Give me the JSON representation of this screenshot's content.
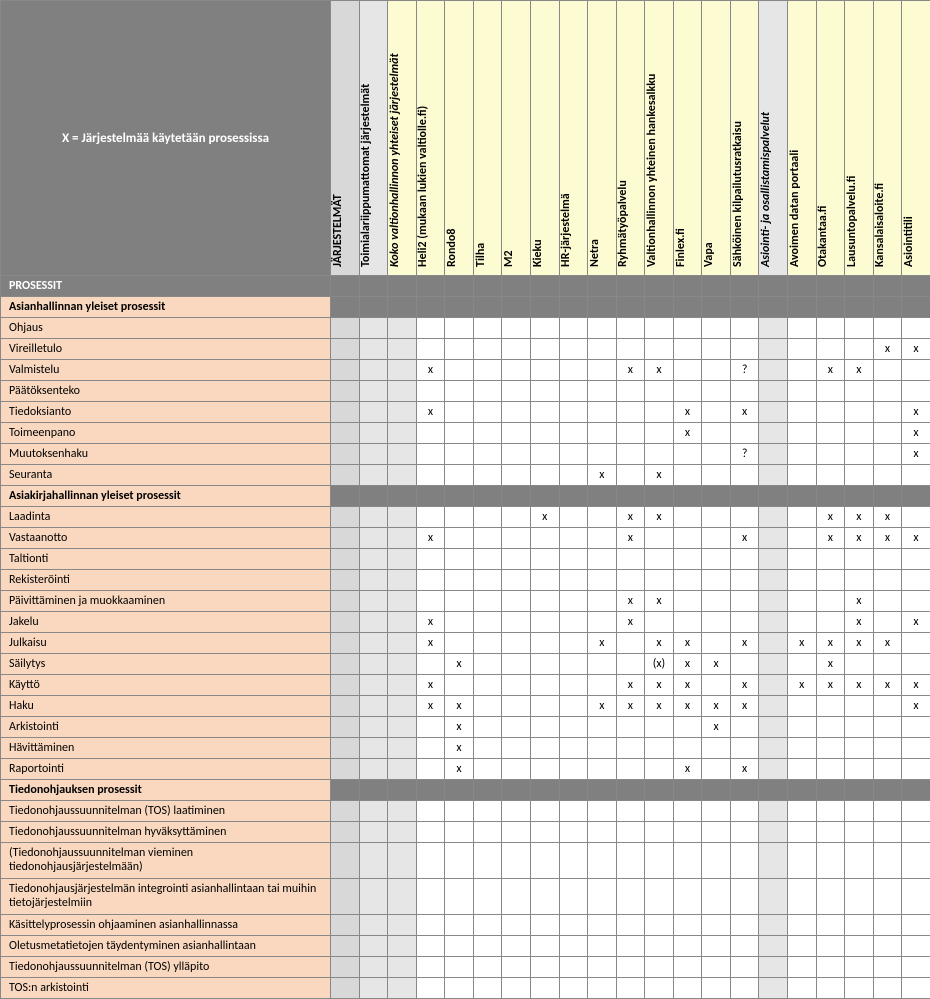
{
  "legend": "X = Järjestelmää käytetään prosessissa",
  "cols": [
    {
      "label": "JÄRJESTELMÄT",
      "style": "bold",
      "bg": "grey1"
    },
    {
      "label": "Toimialariippumattomat järjestelmät",
      "style": "bold",
      "bg": "grey2"
    },
    {
      "label": "Koko valtionhallinnon yhteiset järjestelmät",
      "style": "italic",
      "bg": ""
    },
    {
      "label": "Heli2 (mukaan lukien valtiolle.fi)",
      "style": "",
      "bg": ""
    },
    {
      "label": "Rondo8",
      "style": "",
      "bg": ""
    },
    {
      "label": "Tilha",
      "style": "",
      "bg": ""
    },
    {
      "label": "M2",
      "style": "",
      "bg": ""
    },
    {
      "label": "Kieku",
      "style": "",
      "bg": ""
    },
    {
      "label": "HR-järjestelmä",
      "style": "",
      "bg": ""
    },
    {
      "label": "Netra",
      "style": "",
      "bg": ""
    },
    {
      "label": "Ryhmätyöpalvelu",
      "style": "",
      "bg": ""
    },
    {
      "label": "Valtionhallinnon yhteinen hankesalkku",
      "style": "",
      "bg": ""
    },
    {
      "label": "Finlex.fi",
      "style": "",
      "bg": ""
    },
    {
      "label": "Vapa",
      "style": "",
      "bg": ""
    },
    {
      "label": "Sähköinen kilpailutusratkaisu",
      "style": "",
      "bg": ""
    },
    {
      "label": "Asiointi- ja osallistamispalvelut",
      "style": "italic",
      "bg": "grey2"
    },
    {
      "label": "Avoimen datan portaali",
      "style": "",
      "bg": ""
    },
    {
      "label": "Otakantaa.fi",
      "style": "",
      "bg": ""
    },
    {
      "label": "Lausuntopalvelu.fi",
      "style": "",
      "bg": ""
    },
    {
      "label": "Kansalaisaloite.fi",
      "style": "",
      "bg": ""
    },
    {
      "label": "Asiointitili",
      "style": "",
      "bg": ""
    }
  ],
  "rows": [
    {
      "type": "section",
      "label": "PROSESSIT"
    },
    {
      "type": "subhead",
      "label": "Asianhallinnan yleiset prosessit"
    },
    {
      "type": "row",
      "label": "Ohjaus",
      "cells": [
        "",
        "",
        "",
        "",
        "",
        "",
        "",
        "",
        "",
        "",
        "",
        "",
        "",
        "",
        "",
        "",
        "",
        "",
        "",
        "",
        ""
      ]
    },
    {
      "type": "row",
      "label": "Vireilletulo",
      "cells": [
        "",
        "",
        "",
        "",
        "",
        "",
        "",
        "",
        "",
        "",
        "",
        "",
        "",
        "",
        "",
        "",
        "",
        "",
        "",
        "x",
        "x"
      ]
    },
    {
      "type": "row",
      "label": "Valmistelu",
      "cells": [
        "",
        "",
        "",
        "x",
        "",
        "",
        "",
        "",
        "",
        "",
        "x",
        "x",
        "",
        "",
        "?",
        "",
        "",
        "x",
        "x",
        "",
        ""
      ]
    },
    {
      "type": "row",
      "label": "Päätöksenteko",
      "cells": [
        "",
        "",
        "",
        "",
        "",
        "",
        "",
        "",
        "",
        "",
        "",
        "",
        "",
        "",
        "",
        "",
        "",
        "",
        "",
        "",
        ""
      ]
    },
    {
      "type": "row",
      "label": "Tiedoksianto",
      "cells": [
        "",
        "",
        "",
        "x",
        "",
        "",
        "",
        "",
        "",
        "",
        "",
        "",
        "x",
        "",
        "x",
        "",
        "",
        "",
        "",
        "",
        "x"
      ]
    },
    {
      "type": "row",
      "label": "Toimeenpano",
      "cells": [
        "",
        "",
        "",
        "",
        "",
        "",
        "",
        "",
        "",
        "",
        "",
        "",
        "x",
        "",
        "",
        "",
        "",
        "",
        "",
        "",
        "x"
      ]
    },
    {
      "type": "row",
      "label": "Muutoksenhaku",
      "cells": [
        "",
        "",
        "",
        "",
        "",
        "",
        "",
        "",
        "",
        "",
        "",
        "",
        "",
        "",
        "?",
        "",
        "",
        "",
        "",
        "",
        "x"
      ]
    },
    {
      "type": "row",
      "label": "Seuranta",
      "cells": [
        "",
        "",
        "",
        "",
        "",
        "",
        "",
        "",
        "",
        "x",
        "",
        "x",
        "",
        "",
        "",
        "",
        "",
        "",
        "",
        "",
        ""
      ]
    },
    {
      "type": "subhead",
      "label": "Asiakirjahallinnan yleiset prosessit"
    },
    {
      "type": "row",
      "label": "Laadinta",
      "cells": [
        "",
        "",
        "",
        "",
        "",
        "",
        "",
        "x",
        "",
        "",
        "x",
        "x",
        "",
        "",
        "",
        "",
        "",
        "x",
        "x",
        "x",
        ""
      ]
    },
    {
      "type": "row",
      "label": "Vastaanotto",
      "cells": [
        "",
        "",
        "",
        "x",
        "",
        "",
        "",
        "",
        "",
        "",
        "x",
        "",
        "",
        "",
        "x",
        "",
        "",
        "x",
        "x",
        "x",
        "x"
      ]
    },
    {
      "type": "row",
      "label": "Taltionti",
      "cells": [
        "",
        "",
        "",
        "",
        "",
        "",
        "",
        "",
        "",
        "",
        "",
        "",
        "",
        "",
        "",
        "",
        "",
        "",
        "",
        "",
        ""
      ]
    },
    {
      "type": "row",
      "label": "Rekisteröinti",
      "cells": [
        "",
        "",
        "",
        "",
        "",
        "",
        "",
        "",
        "",
        "",
        "",
        "",
        "",
        "",
        "",
        "",
        "",
        "",
        "",
        "",
        ""
      ]
    },
    {
      "type": "row",
      "label": "Päivittäminen ja muokkaaminen",
      "cells": [
        "",
        "",
        "",
        "",
        "",
        "",
        "",
        "",
        "",
        "",
        "x",
        "x",
        "",
        "",
        "",
        "",
        "",
        "",
        "x",
        "",
        ""
      ]
    },
    {
      "type": "row",
      "label": "Jakelu",
      "cells": [
        "",
        "",
        "",
        "x",
        "",
        "",
        "",
        "",
        "",
        "",
        "x",
        "",
        "",
        "",
        "",
        "",
        "",
        "",
        "x",
        "",
        "x"
      ]
    },
    {
      "type": "row",
      "label": "Julkaisu",
      "cells": [
        "",
        "",
        "",
        "x",
        "",
        "",
        "",
        "",
        "",
        "x",
        "",
        "x",
        "x",
        "",
        "x",
        "",
        "x",
        "x",
        "x",
        "x",
        ""
      ]
    },
    {
      "type": "row",
      "label": "Säilytys",
      "cells": [
        "",
        "",
        "",
        "",
        "x",
        "",
        "",
        "",
        "",
        "",
        "",
        "(x)",
        "x",
        "x",
        "",
        "",
        "",
        "x",
        "",
        "",
        ""
      ]
    },
    {
      "type": "row",
      "label": "Käyttö",
      "cells": [
        "",
        "",
        "",
        "x",
        "",
        "",
        "",
        "",
        "",
        "",
        "x",
        "x",
        "x",
        "",
        "x",
        "",
        "x",
        "x",
        "x",
        "x",
        "x"
      ]
    },
    {
      "type": "row",
      "label": "Haku",
      "cells": [
        "",
        "",
        "",
        "x",
        "x",
        "",
        "",
        "",
        "",
        "x",
        "x",
        "x",
        "x",
        "x",
        "x",
        "",
        "",
        "",
        "",
        "",
        "x"
      ]
    },
    {
      "type": "row",
      "label": "Arkistointi",
      "cells": [
        "",
        "",
        "",
        "",
        "x",
        "",
        "",
        "",
        "",
        "",
        "",
        "",
        "",
        "x",
        "",
        "",
        "",
        "",
        "",
        "",
        ""
      ]
    },
    {
      "type": "row",
      "label": "Hävittäminen",
      "cells": [
        "",
        "",
        "",
        "",
        "x",
        "",
        "",
        "",
        "",
        "",
        "",
        "",
        "",
        "",
        "",
        "",
        "",
        "",
        "",
        "",
        ""
      ]
    },
    {
      "type": "row",
      "label": "Raportointi",
      "cells": [
        "",
        "",
        "",
        "",
        "x",
        "",
        "",
        "",
        "",
        "",
        "",
        "",
        "x",
        "",
        "x",
        "",
        "",
        "",
        "",
        "",
        ""
      ]
    },
    {
      "type": "subhead",
      "label": "Tiedonohjauksen prosessit"
    },
    {
      "type": "row",
      "label": "Tiedonohjaussuunnitelman (TOS) laatiminen",
      "cells": [
        "",
        "",
        "",
        "",
        "",
        "",
        "",
        "",
        "",
        "",
        "",
        "",
        "",
        "",
        "",
        "",
        "",
        "",
        "",
        "",
        ""
      ]
    },
    {
      "type": "row",
      "label": "Tiedonohjaussuunnitelman hyväksyttäminen",
      "cells": [
        "",
        "",
        "",
        "",
        "",
        "",
        "",
        "",
        "",
        "",
        "",
        "",
        "",
        "",
        "",
        "",
        "",
        "",
        "",
        "",
        ""
      ]
    },
    {
      "type": "row",
      "label": "(Tiedonohjaussuunnitelman vieminen tiedonohjausjärjestelmään)",
      "tall": true,
      "cells": [
        "",
        "",
        "",
        "",
        "",
        "",
        "",
        "",
        "",
        "",
        "",
        "",
        "",
        "",
        "",
        "",
        "",
        "",
        "",
        "",
        ""
      ]
    },
    {
      "type": "row",
      "label": "Tiedonohjausjärjestelmän integrointi asianhallintaan tai muihin tietojärjestelmiin",
      "tall": true,
      "cells": [
        "",
        "",
        "",
        "",
        "",
        "",
        "",
        "",
        "",
        "",
        "",
        "",
        "",
        "",
        "",
        "",
        "",
        "",
        "",
        "",
        ""
      ]
    },
    {
      "type": "row",
      "label": "Käsittelyprosessin ohjaaminen asianhallinnassa",
      "cells": [
        "",
        "",
        "",
        "",
        "",
        "",
        "",
        "",
        "",
        "",
        "",
        "",
        "",
        "",
        "",
        "",
        "",
        "",
        "",
        "",
        ""
      ]
    },
    {
      "type": "row",
      "label": "Oletusmetatietojen täydentyminen asianhallintaan",
      "cells": [
        "",
        "",
        "",
        "",
        "",
        "",
        "",
        "",
        "",
        "",
        "",
        "",
        "",
        "",
        "",
        "",
        "",
        "",
        "",
        "",
        ""
      ]
    },
    {
      "type": "row",
      "label": "Tiedonohjaussuunnitelman (TOS) ylläpito",
      "cells": [
        "",
        "",
        "",
        "",
        "",
        "",
        "",
        "",
        "",
        "",
        "",
        "",
        "",
        "",
        "",
        "",
        "",
        "",
        "",
        "",
        ""
      ]
    },
    {
      "type": "row",
      "label": "TOS:n arkistointi",
      "cells": [
        "",
        "",
        "",
        "",
        "",
        "",
        "",
        "",
        "",
        "",
        "",
        "",
        "",
        "",
        "",
        "",
        "",
        "",
        "",
        "",
        ""
      ]
    }
  ]
}
